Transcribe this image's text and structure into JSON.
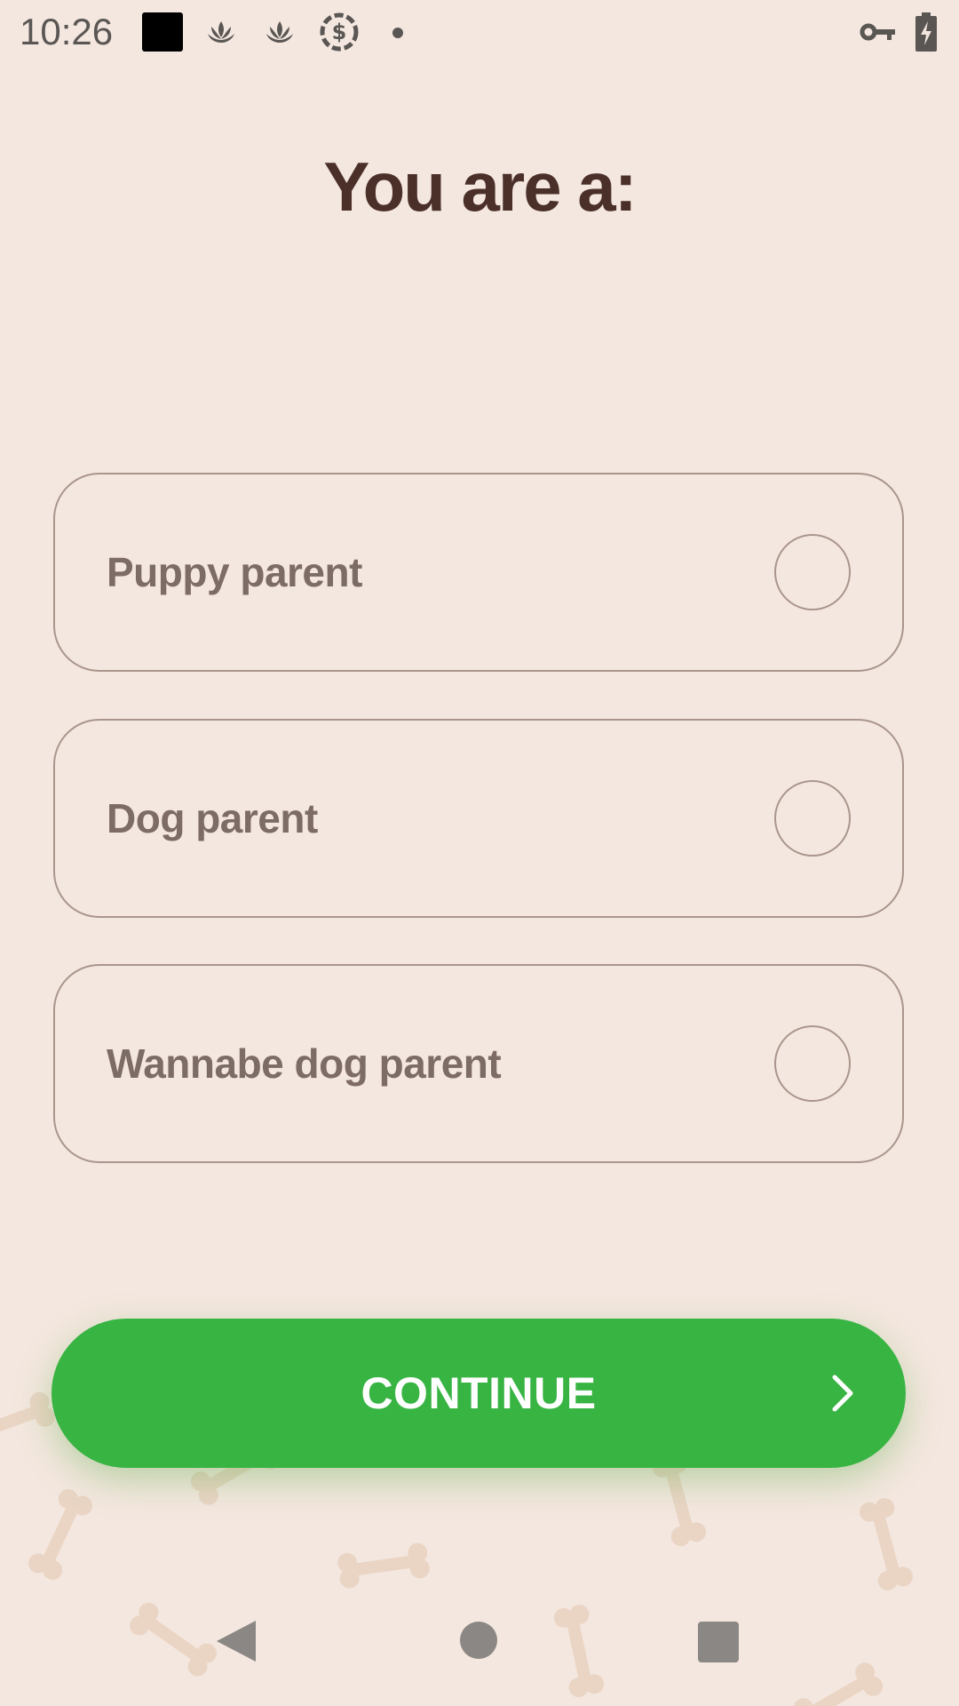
{
  "status_bar": {
    "time": "10:26",
    "icons": [
      "notification-square-icon",
      "lotus-icon",
      "lotus-icon",
      "dollar-sync-icon",
      "dot-icon",
      "vpn-key-icon",
      "battery-charging-icon"
    ]
  },
  "title": "You are a:",
  "options": [
    {
      "label": "Puppy parent",
      "selected": false
    },
    {
      "label": "Dog parent",
      "selected": false
    },
    {
      "label": "Wannabe dog parent",
      "selected": false
    }
  ],
  "continue_button": {
    "label": "CONTINUE",
    "icon": "chevron-right-icon"
  },
  "nav_bar": {
    "icons": [
      "back-icon",
      "home-icon",
      "recents-icon"
    ]
  },
  "colors": {
    "background": "#f4e7df",
    "title": "#4b302a",
    "option_text": "#7d6c66",
    "option_border": "#a9958c",
    "accent_green": "#38b443",
    "bone": "#ead5c5"
  }
}
